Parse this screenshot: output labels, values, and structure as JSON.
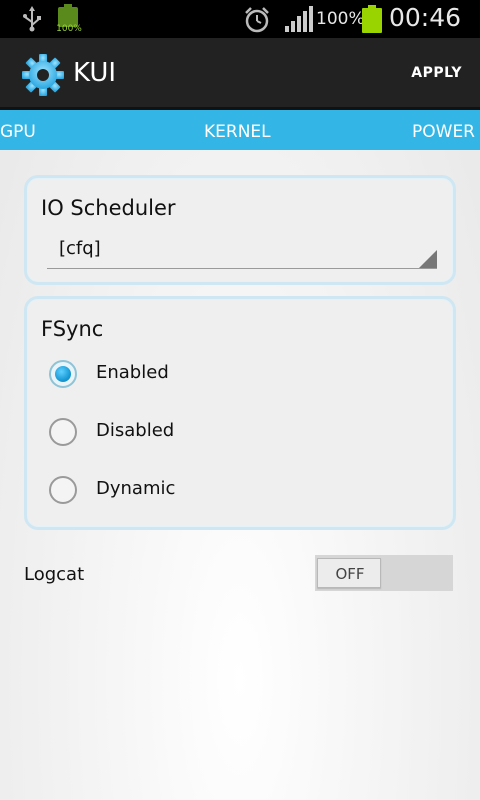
{
  "status_bar": {
    "battery_small_text": "100%",
    "battery_percent": "100%",
    "time": "00:46",
    "icons": [
      "usb-icon",
      "battery-small-icon",
      "alarm-icon",
      "signal-icon",
      "battery-icon"
    ]
  },
  "action_bar": {
    "title": "KUI",
    "apply_label": "APPLY",
    "icon": "gear-icon"
  },
  "tabs": {
    "left": "GPU",
    "center": "KERNEL",
    "right": "POWER"
  },
  "io_scheduler": {
    "title": "IO Scheduler",
    "selected_value": "[cfq]"
  },
  "fsync": {
    "title": "FSync",
    "options": [
      {
        "label": "Enabled",
        "checked": true
      },
      {
        "label": "Disabled",
        "checked": false
      },
      {
        "label": "Dynamic",
        "checked": false
      }
    ]
  },
  "logcat": {
    "label": "Logcat",
    "toggle_text": "OFF",
    "state": "off"
  },
  "colors": {
    "accent": "#33b5e5",
    "action_bar_bg": "#222222",
    "status_bar_bg": "#000000",
    "battery": "#9ad400"
  }
}
